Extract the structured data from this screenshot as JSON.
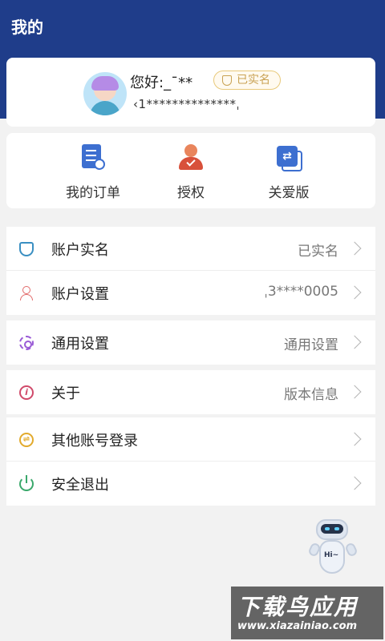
{
  "header": {
    "title": "我的"
  },
  "profile": {
    "greeting": "您好:_ˉ**",
    "verified_badge": "已实名",
    "phone": "‹1**************ˌ"
  },
  "quick_actions": [
    {
      "label": "我的订单",
      "icon": "order-clock-icon"
    },
    {
      "label": "授权",
      "icon": "user-check-icon"
    },
    {
      "label": "关爱版",
      "icon": "care-mode-icon"
    }
  ],
  "menu": {
    "real_name": {
      "label": "账户实名",
      "value": "已实名",
      "icon": "shield-icon"
    },
    "account_settings": {
      "label": "账户设置",
      "value": "ˌ3****0005",
      "icon": "user-settings-icon"
    },
    "general_settings": {
      "label": "通用设置",
      "value": "通用设置",
      "icon": "gear-icon"
    },
    "about": {
      "label": "关于",
      "value": "版本信息",
      "icon": "info-icon"
    },
    "other_login": {
      "label": "其他账号登录",
      "icon": "switch-account-icon"
    },
    "logout": {
      "label": "安全退出",
      "icon": "power-icon"
    }
  },
  "assistant": {
    "label": "Hi~"
  },
  "watermark": {
    "main": "下载鸟应用",
    "sub": "www.xiazainiao.com"
  },
  "colors": {
    "header_bg": "#1f3d8a",
    "badge_gold": "#c9a253",
    "page_bg": "#f2f2f2"
  }
}
